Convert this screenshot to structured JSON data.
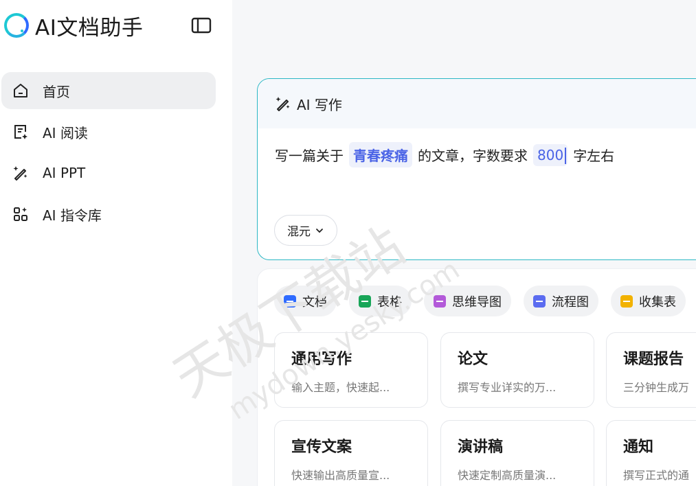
{
  "app": {
    "title": "AI文档助手"
  },
  "nav": [
    {
      "label": "首页",
      "icon": "home-icon",
      "active": true
    },
    {
      "label": "AI 阅读",
      "icon": "reading-icon",
      "active": false
    },
    {
      "label": "AI PPT",
      "icon": "magic-wand-icon",
      "active": false
    },
    {
      "label": "AI 指令库",
      "icon": "apps-icon",
      "active": false
    }
  ],
  "writer": {
    "header": "AI 写作",
    "prompt": {
      "prefix": "写一篇关于",
      "topic": "青春疼痛",
      "middle": "的文章，字数要求",
      "count": "800",
      "suffix": "字左右"
    },
    "model": "混元"
  },
  "chips": [
    {
      "label": "文档",
      "color": "#2f6bff"
    },
    {
      "label": "表格",
      "color": "#18a558"
    },
    {
      "label": "思维导图",
      "color": "#b35ad9"
    },
    {
      "label": "流程图",
      "color": "#5b6cf0"
    },
    {
      "label": "收集表",
      "color": "#f2b200"
    }
  ],
  "tiles": [
    {
      "title": "通用写作",
      "desc": "输入主题，快速起..."
    },
    {
      "title": "论文",
      "desc": "撰写专业详实的万..."
    },
    {
      "title": "课题报告",
      "desc": "三分钟生成万"
    },
    {
      "title": "宣传文案",
      "desc": "快速输出高质量宣..."
    },
    {
      "title": "演讲稿",
      "desc": "快速定制高质量演..."
    },
    {
      "title": "通知",
      "desc": "撰写正式的通"
    }
  ],
  "watermark": {
    "cn": "天极下载站",
    "en": "mydown.yesky.com"
  }
}
